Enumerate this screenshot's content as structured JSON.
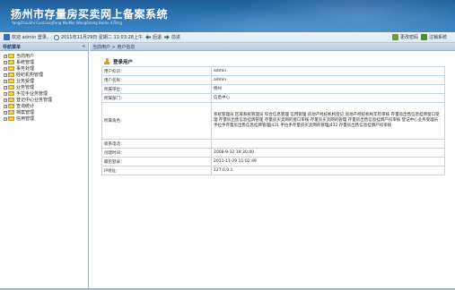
{
  "app": {
    "title": "扬州市存量房买卖网上备案系统",
    "subtitle": "YangZhouShi CunLiangFang MaiMai WangShang BeiAn XiTong"
  },
  "toolbar": {
    "welcome": "欢迎 admin 登录。",
    "datetime": "2011年11月29日 星期二 11:03:28上午",
    "back": "后退",
    "forward": "前进",
    "change_password": "更改密码",
    "logout": "注销系统"
  },
  "sidebar": {
    "title": "导航菜单",
    "collapse": "«",
    "items": [
      {
        "label": "当前用户"
      },
      {
        "label": "系统管理"
      },
      {
        "label": "事务处理"
      },
      {
        "label": "经纪机构管理"
      },
      {
        "label": "业务受理"
      },
      {
        "label": "业务管理"
      },
      {
        "label": "手拉手业务管理"
      },
      {
        "label": "登记中心业务管理"
      },
      {
        "label": "查询统计"
      },
      {
        "label": "档案管理"
      },
      {
        "label": "信用管理"
      }
    ]
  },
  "main": {
    "breadcrumb": "当前用户 > 用户信息",
    "panel_title": "登录用户",
    "rows": [
      {
        "label": "用户标识：",
        "value": "admin"
      },
      {
        "label": "用户名称：",
        "value": "admin"
      },
      {
        "label": "所属单位：",
        "value": "扬州"
      },
      {
        "label": "所属部门：",
        "value": "信息中心"
      },
      {
        "label": "所属角色：",
        "value": "系统管理员 区域系统管理员 综合信息管理 信用管理 房地产经纪机构登记 房地产经纪机构年检审核 存量房出售信息挂牌窗口受理 存量房出售信息挂牌管理 存量房买卖网的窗口审核 存量房买卖网的管理 存量房出售信息挂牌产权审核 登记中心业务受理员 手拉手存量房出售信息挂牌管理J431 手拉手存量房买卖网的管理J432 存量房出售信息挂牌产权审核"
      },
      {
        "label": "联系电话：",
        "value": ""
      },
      {
        "label": "创建时间：",
        "value": "2008-9-12 19:30:40"
      },
      {
        "label": "最后登录：",
        "value": "2011-11-29 11:02:49"
      },
      {
        "label": "IP地址：",
        "value": "127.0.0.1"
      }
    ]
  },
  "colors": {
    "banner": "#2f78b8",
    "panel_header": "#b9cde1",
    "folder": "#f4cf5a",
    "user_icon": "#e38a2b"
  }
}
